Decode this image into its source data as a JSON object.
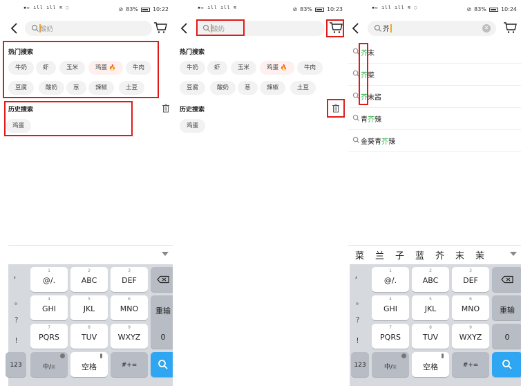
{
  "status": {
    "battery": "83%",
    "times": [
      "10:22",
      "10:23",
      "10:24"
    ]
  },
  "search": {
    "placeholder": "酸奶",
    "typed": "芥"
  },
  "hot": {
    "title": "热门搜索",
    "items": [
      "牛奶",
      "虾",
      "玉米",
      "鸡蛋",
      "牛肉",
      "豆腐",
      "酸奶",
      "葱",
      "辣椒",
      "土豆"
    ],
    "hot_flame": "🔥"
  },
  "history": {
    "title": "历史搜索",
    "items": [
      "鸡蛋"
    ]
  },
  "suggestions": [
    {
      "hl": "芥",
      "rest": "末",
      "pre": ""
    },
    {
      "hl": "芥",
      "rest": "菜",
      "pre": ""
    },
    {
      "hl": "芥",
      "rest": "末酱",
      "pre": ""
    },
    {
      "pre": "青",
      "hl": "芥",
      "rest": "辣"
    },
    {
      "pre": "金葵青",
      "hl": "芥",
      "rest": "辣"
    }
  ],
  "candidates": [
    "菜",
    "兰",
    "子",
    "蓝",
    "芥",
    "末",
    "茉"
  ],
  "keyboard": {
    "punct": [
      "，",
      "。",
      "？",
      "！"
    ],
    "row1": [
      {
        "num": "1",
        "label": "@/."
      },
      {
        "num": "2",
        "label": "ABC"
      },
      {
        "num": "3",
        "label": "DEF"
      }
    ],
    "row2": [
      {
        "num": "4",
        "label": "GHI"
      },
      {
        "num": "5",
        "label": "JKL"
      },
      {
        "num": "6",
        "label": "MNO"
      }
    ],
    "row3": [
      {
        "num": "7",
        "label": "PQRS"
      },
      {
        "num": "8",
        "label": "TUV"
      },
      {
        "num": "9",
        "label": "WXYZ"
      }
    ],
    "enter": "重输",
    "zero": "0",
    "num_key": "123",
    "lang_key": "中/",
    "lang_sub": "英",
    "space": "空格",
    "symbols": "#+="
  },
  "colors": {
    "highlight": "#26b043",
    "annotation": "#e01919",
    "cursor": "#f5a623",
    "search_key": "#2ea6f2"
  }
}
